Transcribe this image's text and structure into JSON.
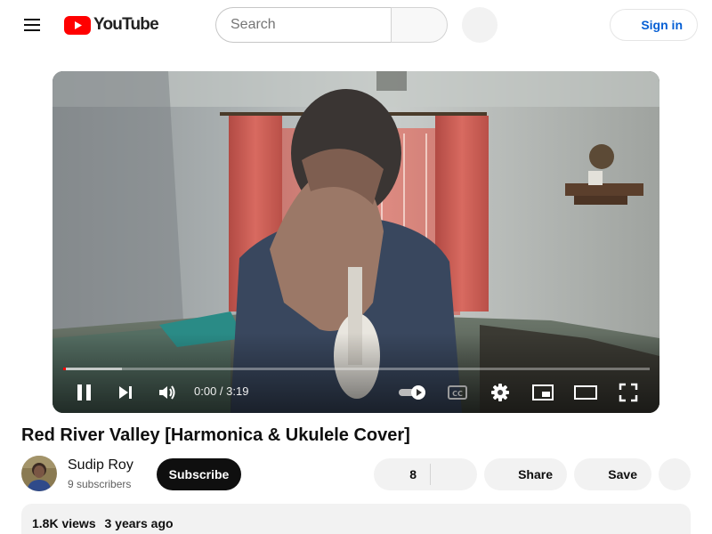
{
  "masthead": {
    "logo_text": "YouTube",
    "search_placeholder": "Search",
    "signin_label": "Sign in"
  },
  "player": {
    "time_current": "0:00",
    "time_separator": " / ",
    "time_total": "3:19",
    "progress_fraction": 0.003,
    "state": "playing"
  },
  "video": {
    "title": "Red River Valley [Harmonica & Ukulele Cover]"
  },
  "owner": {
    "channel_name": "Sudip Roy",
    "subscribers": "9 subscribers",
    "subscribe_label": "Subscribe"
  },
  "actions": {
    "like_count": "8",
    "share_label": "Share",
    "save_label": "Save"
  },
  "description": {
    "views": "1.8K views",
    "age": "3 years ago"
  },
  "colors": {
    "brand_red": "#ff0000",
    "link_blue": "#065fd4",
    "pill_bg": "#f2f2f2",
    "subscribe_bg": "#0f0f0f"
  },
  "icons": {
    "menu": "hamburger-menu-icon",
    "play_state": "pause-icon",
    "next": "skip-next-icon",
    "volume": "volume-icon",
    "autoplay": "autoplay-toggle-icon",
    "captions": "closed-captions-icon",
    "settings": "gear-icon",
    "miniplayer": "miniplayer-icon",
    "theater": "theater-mode-icon",
    "fullscreen": "fullscreen-icon"
  }
}
